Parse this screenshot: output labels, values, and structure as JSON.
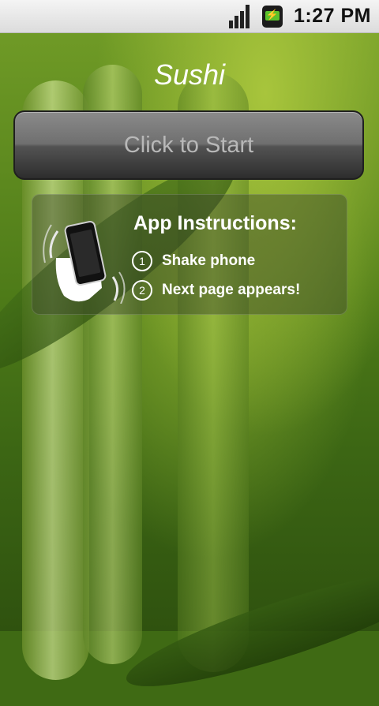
{
  "status_bar": {
    "time": "1:27 PM",
    "signal_icon": "signal-icon",
    "battery_icon": "battery-charging-icon"
  },
  "app": {
    "title": "Sushi",
    "start_button_label": "Click to Start"
  },
  "instructions": {
    "title": "App Instructions:",
    "icon": "shake-phone-icon",
    "steps": [
      {
        "number": "1",
        "text": "Shake phone"
      },
      {
        "number": "2",
        "text": "Next page appears!"
      }
    ]
  }
}
